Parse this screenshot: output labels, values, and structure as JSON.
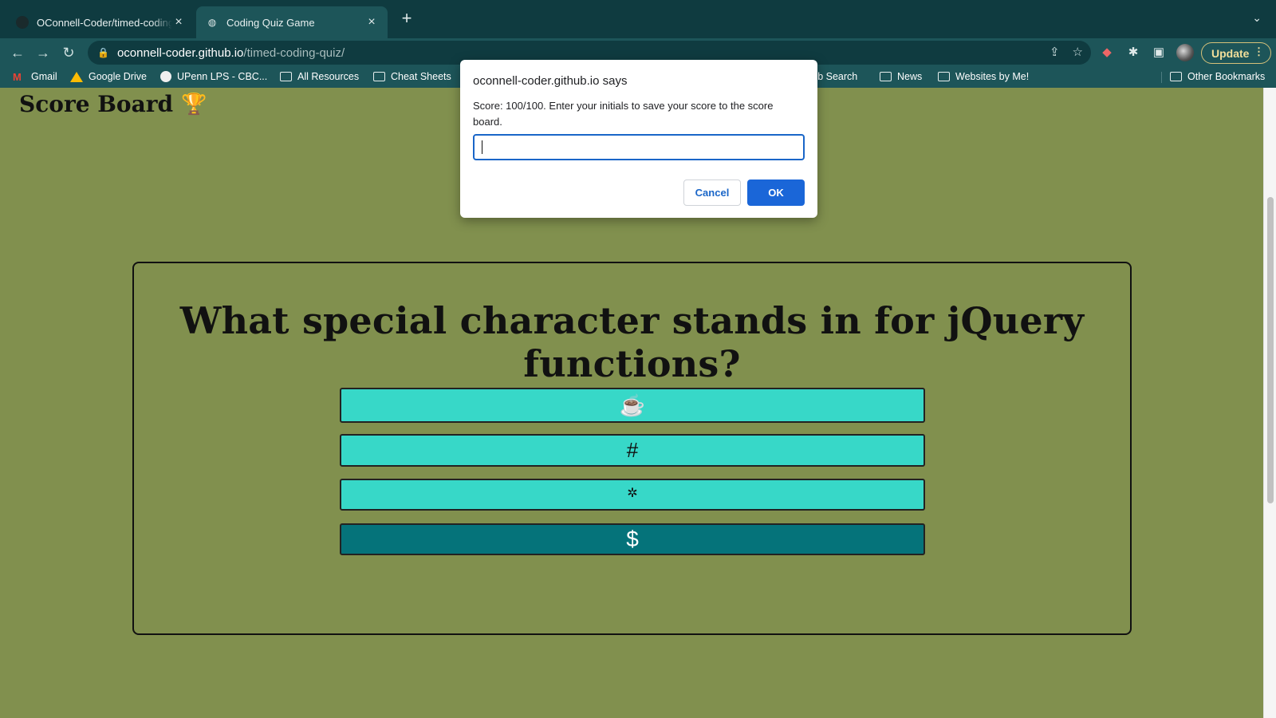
{
  "browser": {
    "tabs": [
      {
        "title": "OConnell-Coder/timed-coding",
        "active": false
      },
      {
        "title": "Coding Quiz Game",
        "active": true
      }
    ],
    "url_host": "oconnell-coder.github.io",
    "url_path": "/timed-coding-quiz/",
    "update_label": "Update",
    "bookmarks": [
      {
        "label": "Gmail",
        "icon": "gmail-icon"
      },
      {
        "label": "Google Drive",
        "icon": "drive-icon"
      },
      {
        "label": "UPenn LPS - CBC...",
        "icon": "globe-icon"
      },
      {
        "label": "All Resources",
        "icon": "folder-icon"
      },
      {
        "label": "Cheat Sheets",
        "icon": "folder-icon"
      },
      {
        "label": "Job Search",
        "icon": "folder-icon"
      },
      {
        "label": "News",
        "icon": "folder-icon"
      },
      {
        "label": "Websites by Me!",
        "icon": "folder-icon"
      },
      {
        "label": "Other Bookmarks",
        "icon": "folder-icon"
      }
    ]
  },
  "page": {
    "scoreboard_label": "Score Board",
    "trophy_glyph": "🏆",
    "question": "What special character stands in for jQuery functions?",
    "answers": [
      "☕",
      "#",
      "✲",
      "$"
    ]
  },
  "dialog": {
    "title": "oconnell-coder.github.io says",
    "message": "Score: 100/100. Enter your initials to save your score to the score board.",
    "input_value": "",
    "cancel_label": "Cancel",
    "ok_label": "OK"
  },
  "colors": {
    "page_bg": "#81904e",
    "answer_bg": "#37d8c8",
    "answer_selected_bg": "#05737a",
    "chrome_dark": "#0f3b40",
    "chrome_mid": "#1d5559",
    "dialog_accent": "#1a66d8"
  }
}
